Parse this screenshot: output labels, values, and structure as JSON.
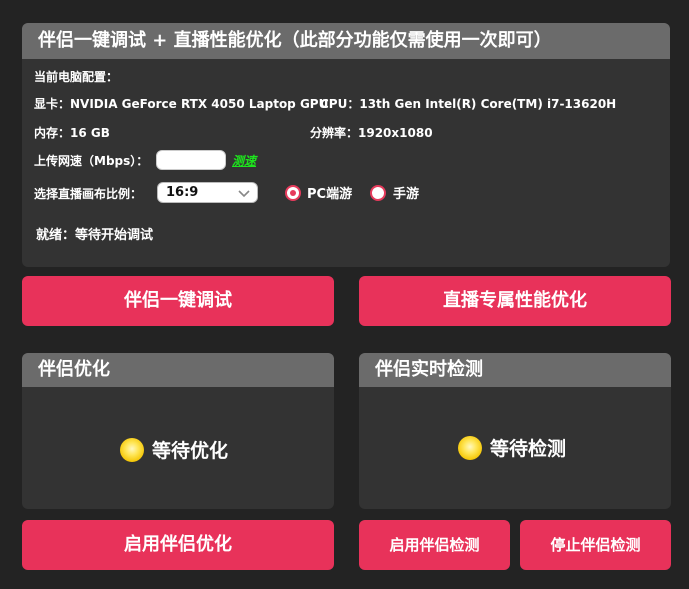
{
  "top": {
    "title": "伴侣一键调试 + 直播性能优化（此部分功能仅需使用一次即可）",
    "config_heading": "当前电脑配置：",
    "gpu": "显卡：NVIDIA GeForce RTX 4050 Laptop GPU",
    "cpu": "CPU：13th Gen Intel(R) Core(TM) i7-13620H",
    "memory": "内存：16 GB",
    "resolution": "分辨率：1920x1080",
    "upload_label": "上传网速（Mbps）：",
    "upload_value": "",
    "speed_test_link": "测速",
    "ratio_label": "选择直播画布比例：",
    "ratio_selected": "16:9",
    "radio_pc": "PC端游",
    "radio_mobile": "手游",
    "radio_selected": "pc",
    "status": "就绪：等待开始调试"
  },
  "buttons": {
    "one_click_debug": "伴侣一键调试",
    "perf_optimize": "直播专属性能优化",
    "enable_optimize": "启用伴侣优化",
    "enable_detect": "启用伴侣检测",
    "stop_detect": "停止伴侣检测"
  },
  "optimize_panel": {
    "title": "伴侣优化",
    "status": "等待优化"
  },
  "detect_panel": {
    "title": "伴侣实时检测",
    "status": "等待检测"
  },
  "colors": {
    "accent": "#e8325a",
    "background": "#232323",
    "panel": "#333333",
    "header": "#6b6b6b",
    "link_green": "#1de51d",
    "status_yellow": "#ffe657"
  },
  "icons": {
    "status_indicator": "yellow-circle",
    "select_arrow": "chevron-down"
  }
}
